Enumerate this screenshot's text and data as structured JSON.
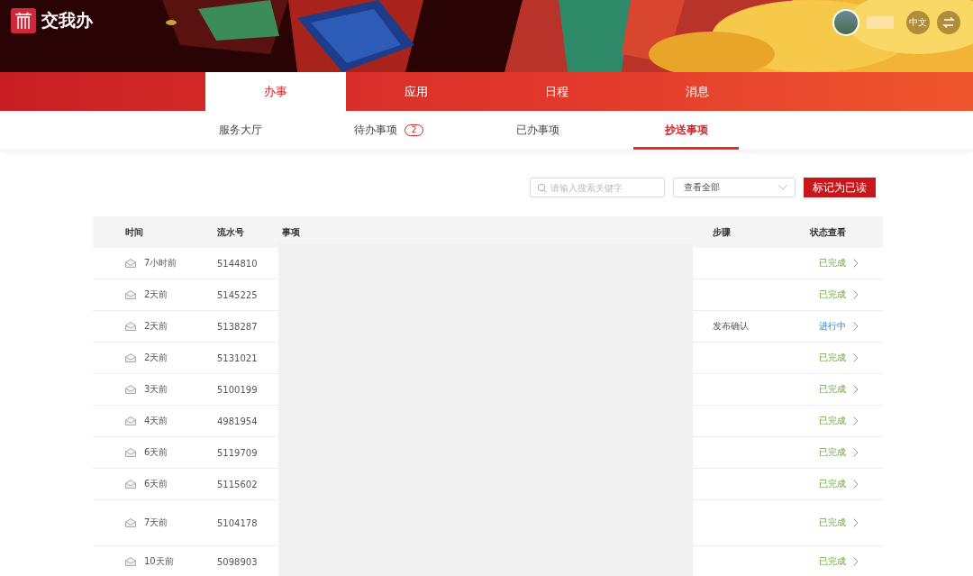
{
  "header": {
    "app_name": "交我办",
    "language_button": "中文"
  },
  "main_tabs": [
    {
      "label": "办事",
      "selected": true
    },
    {
      "label": "应用",
      "selected": false
    },
    {
      "label": "日程",
      "selected": false
    },
    {
      "label": "消息",
      "selected": false
    }
  ],
  "sub_tabs": [
    {
      "label": "服务大厅",
      "selected": false
    },
    {
      "label": "待办事项",
      "selected": false,
      "badge": "2"
    },
    {
      "label": "已办事项",
      "selected": false
    },
    {
      "label": "抄送事项",
      "selected": true
    }
  ],
  "toolbar": {
    "search": {
      "placeholder": "请输入搜索关键字"
    },
    "filter": {
      "value": "查看全部"
    },
    "mark_read_button": "标记为已读"
  },
  "table": {
    "columns": [
      "时间",
      "流水号",
      "事项",
      "步骤",
      "状态查看"
    ],
    "rows": [
      {
        "time": "7小时前",
        "serial": "5144810",
        "step": "",
        "status": {
          "text": "已完成",
          "kind": "done"
        }
      },
      {
        "time": "2天前",
        "serial": "5145225",
        "step": "",
        "status": {
          "text": "已完成",
          "kind": "done"
        }
      },
      {
        "time": "2天前",
        "serial": "5138287",
        "step": "发布确认",
        "status": {
          "text": "进行中",
          "kind": "in_progress"
        }
      },
      {
        "time": "2天前",
        "serial": "5131021",
        "step": "",
        "status": {
          "text": "已完成",
          "kind": "done"
        }
      },
      {
        "time": "3天前",
        "serial": "5100199",
        "step": "",
        "status": {
          "text": "已完成",
          "kind": "done"
        }
      },
      {
        "time": "4天前",
        "serial": "4981954",
        "step": "",
        "status": {
          "text": "已完成",
          "kind": "done"
        }
      },
      {
        "time": "6天前",
        "serial": "5119709",
        "step": "",
        "status": {
          "text": "已完成",
          "kind": "done"
        }
      },
      {
        "time": "6天前",
        "serial": "5115602",
        "step": "",
        "status": {
          "text": "已完成",
          "kind": "done"
        }
      },
      {
        "time": "7天前",
        "serial": "5104178",
        "step": "",
        "status": {
          "text": "已完成",
          "kind": "done"
        }
      },
      {
        "time": "10天前",
        "serial": "5098903",
        "step": "",
        "status": {
          "text": "已完成",
          "kind": "done"
        }
      }
    ]
  }
}
